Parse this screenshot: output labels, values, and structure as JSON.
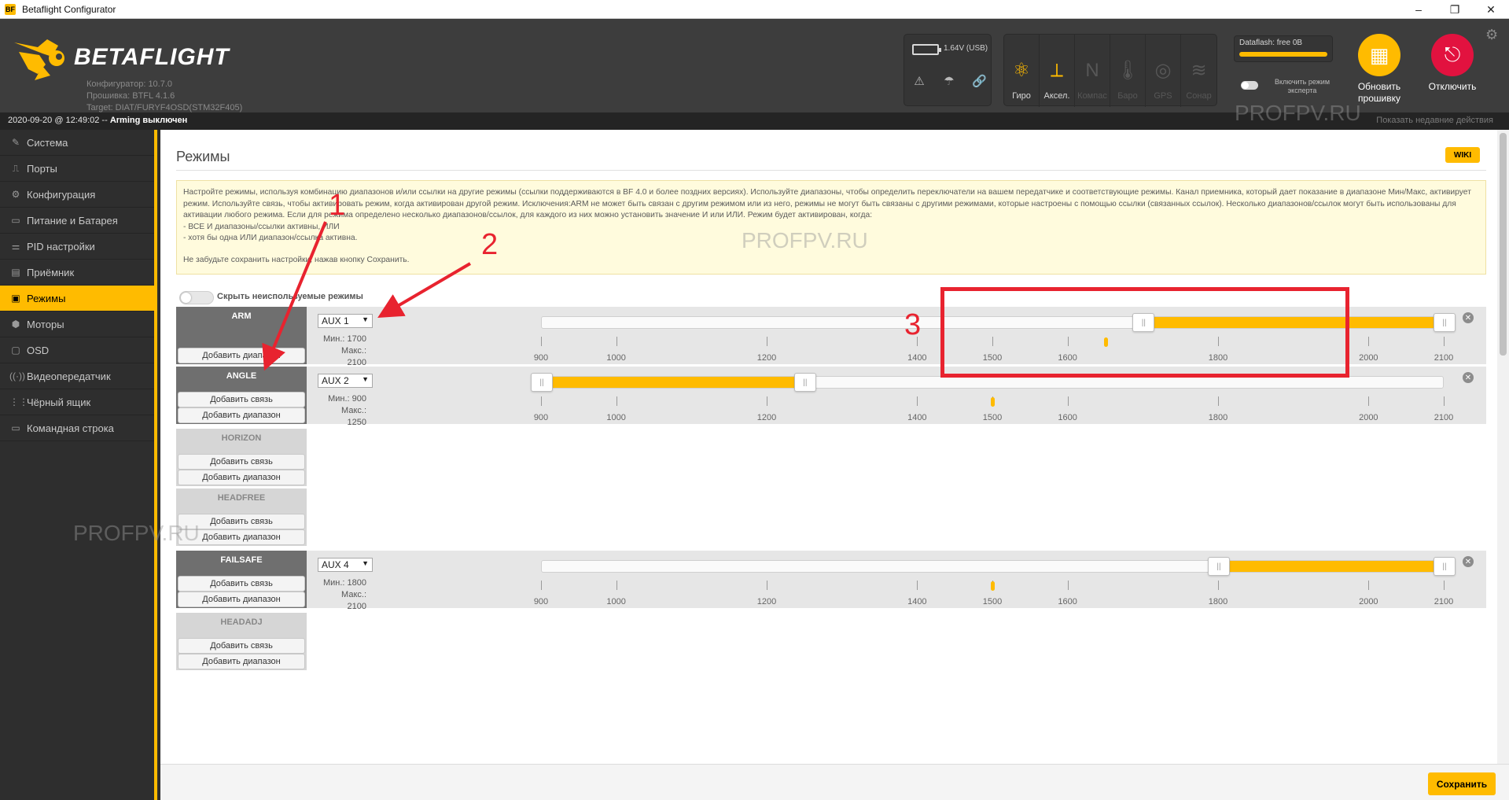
{
  "window": {
    "title": "Betaflight Configurator",
    "app_icon": "BF"
  },
  "header": {
    "logo_text": "BETAFLIGHT",
    "configurator": "Конфигуратор: 10.7.0",
    "firmware": "Прошивка: BTFL 4.1.6",
    "target": "Target: DIAT/FURYF4OSD(STM32F405)",
    "voltage": "1.64V (USB)",
    "sensors": [
      {
        "label": "Гиро",
        "icon": "gyro-icon",
        "glyph": "⚛",
        "active": true
      },
      {
        "label": "Аксел.",
        "icon": "accelerometer-icon",
        "glyph": "⟂",
        "active": true
      },
      {
        "label": "Компас",
        "icon": "compass-icon",
        "glyph": "N",
        "active": false
      },
      {
        "label": "Баро",
        "icon": "barometer-icon",
        "glyph": "🌡",
        "active": false
      },
      {
        "label": "GPS",
        "icon": "gps-icon",
        "glyph": "◎",
        "active": false
      },
      {
        "label": "Сонар",
        "icon": "sonar-icon",
        "glyph": "≋",
        "active": false
      }
    ],
    "dataflash": "Dataflash: free 0B",
    "expert_mode": "Включить режим эксперта",
    "update_firmware": "Обновить прошивку",
    "disconnect": "Отключить"
  },
  "statusbar": {
    "datetime": "2020-09-20 @ 12:49:02 --",
    "arming": "Arming выключен",
    "recent": "Показать недавние действия"
  },
  "sidebar": [
    {
      "label": "Система",
      "icon": "wrench-icon",
      "glyph": "✎"
    },
    {
      "label": "Порты",
      "icon": "ports-icon",
      "glyph": "⎍"
    },
    {
      "label": "Конфигурация",
      "icon": "gear-icon",
      "glyph": "⚙"
    },
    {
      "label": "Питание и Батарея",
      "icon": "battery-icon",
      "glyph": "▭"
    },
    {
      "label": "PID настройки",
      "icon": "pid-icon",
      "glyph": "⚌"
    },
    {
      "label": "Приёмник",
      "icon": "receiver-icon",
      "glyph": "▤"
    },
    {
      "label": "Режимы",
      "icon": "modes-icon",
      "glyph": "▣",
      "active": true
    },
    {
      "label": "Моторы",
      "icon": "motor-icon",
      "glyph": "⬢"
    },
    {
      "label": "OSD",
      "icon": "osd-icon",
      "glyph": "▢"
    },
    {
      "label": "Видеопередатчик",
      "icon": "vtx-icon",
      "glyph": "((·))"
    },
    {
      "label": "Чёрный ящик",
      "icon": "blackbox-icon",
      "glyph": "⋮⋮"
    },
    {
      "label": "Командная строка",
      "icon": "cli-icon",
      "glyph": "▭"
    }
  ],
  "page": {
    "title": "Режимы",
    "wiki": "WIKI",
    "note_line1": "Настройте режимы, используя комбинацию диапазонов и/или ссылки на другие режимы (ссылки поддерживаются в BF 4.0 и более поздних версиях). Используйте диапазоны, чтобы определить переключатели на вашем передатчике и соответствующие режимы. Канал приемника, который дает показание в диапазоне Мин/Макс, активирует режим. Используйте связь, чтобы активировать режим, когда активирован другой режим. Исключения:ARM не может быть связан с другим режимом или из него, режимы не могут быть связаны с другими режимами, которые настроены с помощью ссылки (связанных ссылок). Несколько диапазонов/ссылок могут быть использованы для активации любого режима. Если для режима определено несколько диапазонов/ссылок, для каждого из них можно установить значение И или ИЛИ. Режим будет активирован, когда:",
    "note_line2": "- ВСЕ И диапазоны/ссылки активны, ИЛИ",
    "note_line3": "- хотя бы одна ИЛИ диапазон/ссылка активна.",
    "note_tail": "Не забудьте сохранить настройки, нажав кнопку Сохранить.",
    "hide_unused": "Скрыть неиспользуемые режимы",
    "add_link": "Добавить связь",
    "add_range": "Добавить диапазон",
    "min_prefix": "Мин.:",
    "max_prefix": "Макс.:",
    "save": "Сохранить"
  },
  "modes": [
    {
      "name": "ARM",
      "has_link": false,
      "range": {
        "aux": "AUX 1",
        "min": "1700",
        "max": "2100",
        "min_value": 1700,
        "max_value": 2100,
        "current": 1650
      }
    },
    {
      "name": "ANGLE",
      "has_link": true,
      "range": {
        "aux": "AUX 2",
        "min": "900",
        "max": "1250",
        "min_value": 900,
        "max_value": 1250,
        "current": 1500
      }
    },
    {
      "name": "HORIZON",
      "has_link": true,
      "range": null
    },
    {
      "name": "HEADFREE",
      "has_link": true,
      "range": null
    },
    {
      "name": "FAILSAFE",
      "has_link": true,
      "range": {
        "aux": "AUX 4",
        "min": "1800",
        "max": "2100",
        "min_value": 1800,
        "max_value": 2100,
        "current": 1500
      }
    },
    {
      "name": "HEADADJ",
      "has_link": true,
      "range": null
    }
  ],
  "scale": {
    "ticks": [
      "900",
      "1000",
      "1200",
      "1400",
      "1500",
      "1600",
      "1800",
      "2000",
      "2100"
    ]
  },
  "annotations": [
    "1",
    "2",
    "3"
  ],
  "watermark": "PROFPV.RU",
  "colors": {
    "accent": "#ffbb00",
    "danger": "#e2123f",
    "annotation": "#e8232f"
  }
}
